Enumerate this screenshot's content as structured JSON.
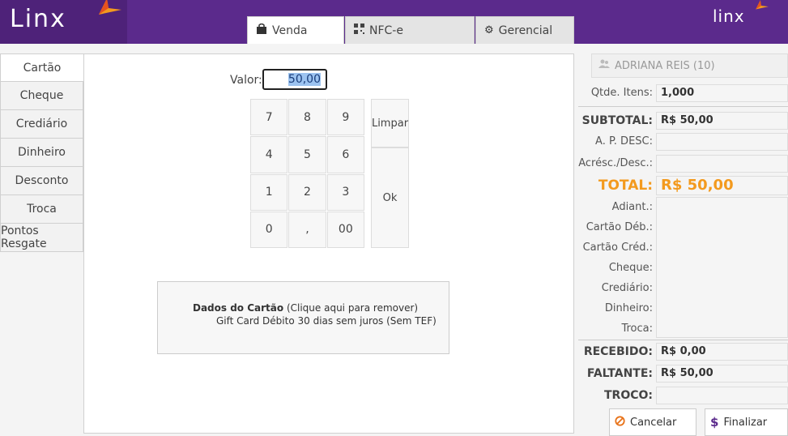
{
  "brand": {
    "logo_text": "Linx",
    "logo_text_right": "linx"
  },
  "tabs": [
    {
      "label": "Venda",
      "icon": "shopping-bag-icon"
    },
    {
      "label": "NFC-e",
      "icon": "qr-code-icon"
    },
    {
      "label": "Gerencial",
      "icon": "gears-icon"
    }
  ],
  "payment_methods": [
    "Cartão",
    "Cheque",
    "Crediário",
    "Dinheiro",
    "Desconto",
    "Troca",
    "Pontos Resgate"
  ],
  "entry": {
    "label": "Valor:",
    "value": "50,00"
  },
  "keypad": {
    "keys": [
      "7",
      "8",
      "9",
      "4",
      "5",
      "6",
      "1",
      "2",
      "3",
      "0",
      ",",
      "00"
    ],
    "clear_label": "Limpar",
    "ok_label": "Ok"
  },
  "card_data": {
    "title": "Dados do Cartão",
    "hint": "(Clique aqui para remover)",
    "description": "Gift Card Débito 30 dias sem juros (Sem TEF)"
  },
  "summary": {
    "client": "ADRIANA REIS (10)",
    "qty_label": "Qtde. Itens:",
    "qty_value": "1,000",
    "subtotal_label": "SUBTOTAL:",
    "subtotal_value": "R$ 50,00",
    "ap_desc_label": "A. P. DESC:",
    "ap_desc_value": "",
    "acresc_label": "Acrésc./Desc.:",
    "acresc_value": "",
    "total_label": "TOTAL:",
    "total_value": "R$ 50,00",
    "payments": [
      "Adiant.:",
      "Cartão Déb.:",
      "Cartão Créd.:",
      "Cheque:",
      "Crediário:",
      "Dinheiro:",
      "Troca:"
    ],
    "recebido_label": "RECEBIDO:",
    "recebido_value": "R$ 0,00",
    "faltante_label": "FALTANTE:",
    "faltante_value": "R$ 50,00",
    "troco_label": "TROCO:",
    "troco_value": ""
  },
  "actions": {
    "cancel_label": "Cancelar",
    "finalize_label": "Finalizar"
  },
  "colors": {
    "header": "#5b2a8c",
    "accent": "#f39a1e",
    "cancel": "#e8731a"
  }
}
